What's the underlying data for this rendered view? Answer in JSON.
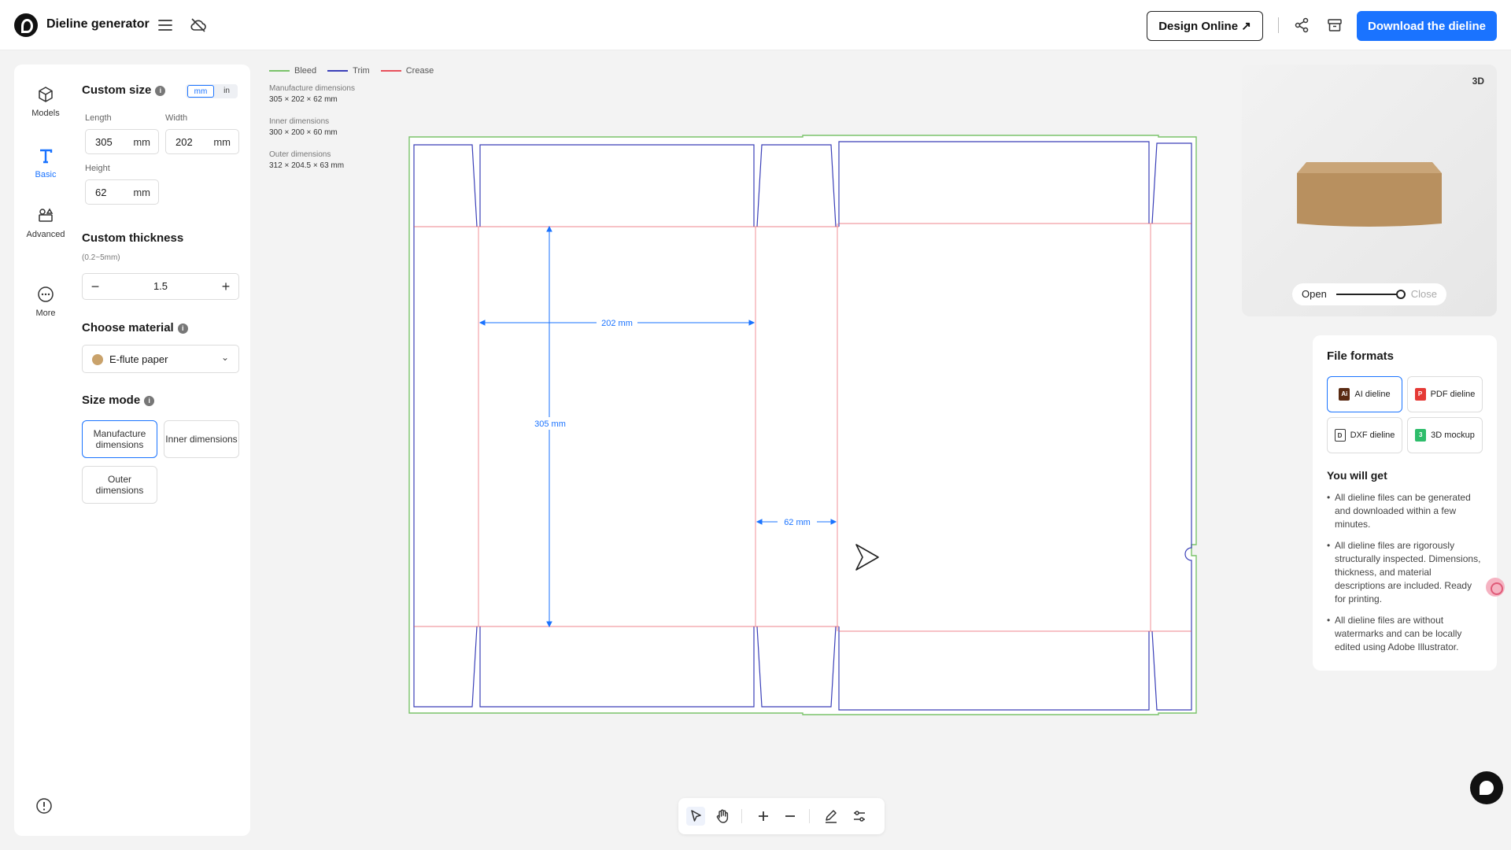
{
  "header": {
    "title": "Dieline generator",
    "design_online": "Design Online ↗",
    "download": "Download the dieline"
  },
  "nav": {
    "models": "Models",
    "basic": "Basic",
    "advanced": "Advanced",
    "more": "More"
  },
  "custom_size": {
    "title": "Custom size",
    "unit_mm": "mm",
    "unit_in": "in",
    "length_label": "Length",
    "length_value": "305",
    "width_label": "Width",
    "width_value": "202",
    "height_label": "Height",
    "height_value": "62",
    "unit": "mm"
  },
  "thickness": {
    "title": "Custom thickness",
    "range": "(0.2~5mm)",
    "value": "1.5",
    "minus": "−",
    "plus": "+"
  },
  "material": {
    "title": "Choose material",
    "selected": "E-flute paper"
  },
  "size_mode": {
    "title": "Size mode",
    "manufacture": "Manufacture dimensions",
    "inner": "Inner dimensions",
    "outer": "Outer dimensions"
  },
  "legend": {
    "bleed": "Bleed",
    "trim": "Trim",
    "crease": "Crease"
  },
  "dimensions": {
    "manufacture_label": "Manufacture dimensions",
    "manufacture_value": "305 × 202 × 62 mm",
    "inner_label": "Inner dimensions",
    "inner_value": "300 × 200 × 60 mm",
    "outer_label": "Outer dimensions",
    "outer_value": "312 × 204.5 × 63 mm"
  },
  "dieline_labels": {
    "width": "202 mm",
    "length": "305 mm",
    "height": "62 mm"
  },
  "colors": {
    "bleed": "#7ac36a",
    "trim": "#3a3fb8",
    "crease": "#e8505b",
    "dimension": "#1a73ff",
    "accent": "#1a73ff"
  },
  "preview": {
    "badge": "3D",
    "open": "Open",
    "close": "Close",
    "open_level": 1.0
  },
  "formats": {
    "title": "File formats",
    "ai": "AI dieline",
    "pdf": "PDF dieline",
    "dxf": "DXF dieline",
    "mockup": "3D mockup",
    "you_get": "You will get",
    "bullets": [
      "All dieline files can be generated and downloaded within a few minutes.",
      "All dieline files are rigorously structurally inspected. Dimensions, thickness, and material descriptions are included. Ready for printing.",
      "All dieline files are without watermarks and can be locally edited using Adobe Illustrator."
    ]
  }
}
